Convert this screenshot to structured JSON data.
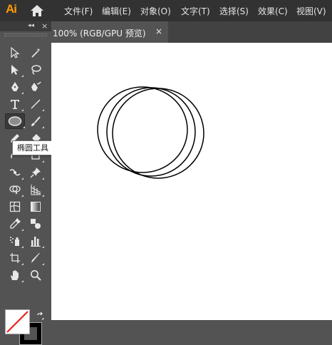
{
  "app": {
    "logo": "Ai"
  },
  "menu": [
    "文件(F)",
    "编辑(E)",
    "对象(O)",
    "文字(T)",
    "选择(S)",
    "效果(C)",
    "视图(V)"
  ],
  "tools_panel": {
    "collapse": "◂◂",
    "close": "×"
  },
  "tooltip": "椭圆工具 (L)",
  "document": {
    "tab_title": "100% (RGB/GPU 预览)",
    "tab_close": "×"
  },
  "colors": {
    "chrome": "#323232",
    "panel": "#535353",
    "canvas": "#ffffff",
    "logo": "#ff9a00"
  },
  "canvas_shapes": [
    "ellipse",
    "ellipse",
    "ellipse"
  ]
}
